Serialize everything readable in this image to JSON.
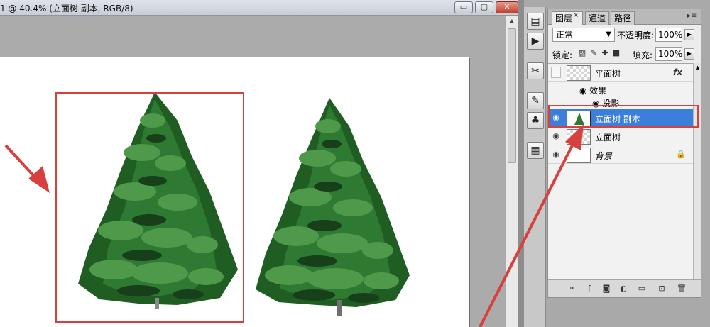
{
  "document": {
    "title": "1 @ 40.4% (立面树 副本, RGB/8)",
    "window_buttons": {
      "minimize": "▭",
      "maximize": "▢",
      "close": "✕"
    }
  },
  "layers_panel": {
    "tabs": [
      {
        "label": "图层",
        "active": true
      },
      {
        "label": "通道",
        "active": false
      },
      {
        "label": "路径",
        "active": false
      }
    ],
    "tab_close": "×",
    "menu_icon": "▸≡",
    "blend_mode": "正常",
    "opacity_label": "不透明度:",
    "opacity_value": "100%",
    "lock_label": "锁定:",
    "fill_label": "填充:",
    "fill_value": "100%",
    "layers": [
      {
        "name": "平面树",
        "visible": false,
        "fx": "fx",
        "selected": false
      },
      {
        "name": "立面树 副本",
        "visible": true,
        "selected": true
      },
      {
        "name": "立面树",
        "visible": true,
        "selected": false
      },
      {
        "name": "背景",
        "visible": true,
        "locked": true,
        "selected": false
      }
    ],
    "effects_label": "效果",
    "effect_item": "投影"
  },
  "colors": {
    "annotation_red": "#d8403d",
    "selected_row": "#3b7edc",
    "tree_dark": "#1f5d23",
    "tree_mid": "#2f7a33",
    "tree_light": "#4e9a4a"
  }
}
